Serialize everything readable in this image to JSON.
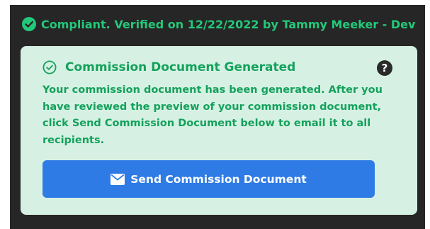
{
  "status": {
    "text": "Compliant. Verified on 12/22/2022 by Tammy Meeker - Dev",
    "icon": "check-circle-filled-icon",
    "color": "#23c97a"
  },
  "card": {
    "title": "Commission Document Generated",
    "title_icon": "check-circle-outline-icon",
    "help_icon": "question-circle-icon",
    "body": "Your commission document has been generated. After you have reviewed the preview of your commission document, click Send Commission Document below to email it to all recipients.",
    "background": "#d6f1e4",
    "text_color": "#14a15b"
  },
  "send_button": {
    "label": "Send Commission Document",
    "icon": "envelope-icon",
    "color": "#2e7be6"
  },
  "frame_color": "#262626"
}
